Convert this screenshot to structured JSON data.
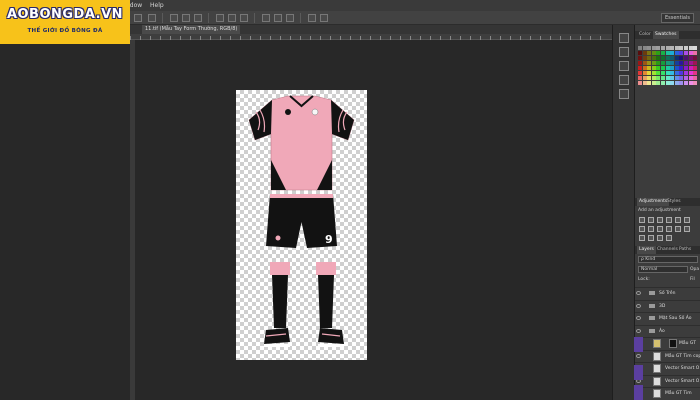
{
  "logo": {
    "title": "AOBONGDA.VN",
    "subtitle": "THẾ GIỚI ĐỒ BÓNG ĐÁ"
  },
  "menu": {
    "window": "ndow",
    "help": "Help"
  },
  "options": {
    "workspace": "Essentials"
  },
  "document": {
    "tab_title": "11.tif (Mẫu Tay Form Thường, RGB/8)"
  },
  "canvas": {
    "shirt_color": "#f0a8b8",
    "dark_color": "#121212",
    "shorts_number": "9"
  },
  "panels": {
    "color_tabs": [
      "Color",
      "Swatches"
    ],
    "adjust_tabs": [
      "Adjustments",
      "Styles"
    ],
    "adjust_hint": "Add an adjustment",
    "layer_tabs": [
      "Layers",
      "Channels",
      "Paths"
    ],
    "kind_label": "ρ Kind",
    "blend_mode": "Normal",
    "opacity_label": "Opa",
    "lock_label": "Lock:",
    "fill_label": "Fil",
    "layers": [
      {
        "name": "Số Trên",
        "type": "folder"
      },
      {
        "name": "3D",
        "type": "folder"
      },
      {
        "name": "Mặt Sau Số Áo",
        "type": "folder"
      },
      {
        "name": "Áo",
        "type": "folder"
      },
      {
        "name": "Mẫu GT",
        "type": "thumb-pair"
      },
      {
        "name": "Mẫu GT Tim copy",
        "type": "thumb"
      },
      {
        "name": "Vector Smart O",
        "type": "thumb"
      },
      {
        "name": "Vector Smart O",
        "type": "thumb"
      },
      {
        "name": "Mẫu GT Tim",
        "type": "thumb"
      }
    ]
  },
  "colors": {
    "accent_logo": "#f7c21a",
    "app_bg": "#282828",
    "layer_purple": "#5b3fa0"
  }
}
